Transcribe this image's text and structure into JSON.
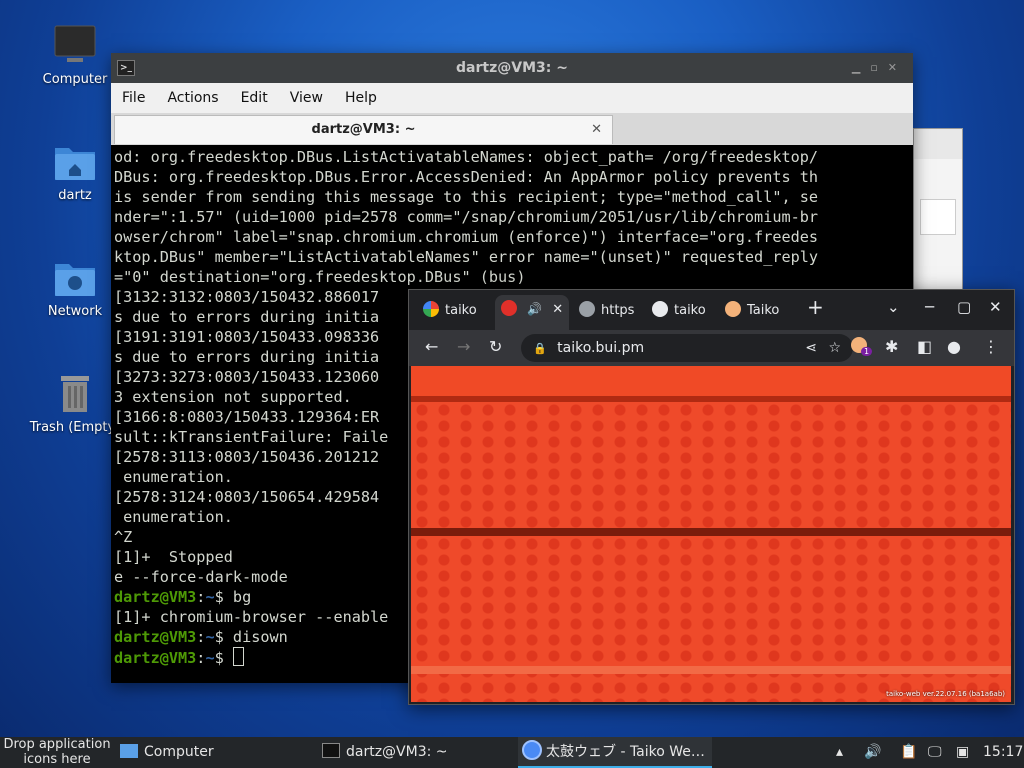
{
  "desktop": {
    "icons": [
      {
        "label": "Computer"
      },
      {
        "label": "dartz"
      },
      {
        "label": "Network"
      },
      {
        "label": "Trash (Empty)"
      }
    ]
  },
  "terminal": {
    "title": "dartz@VM3: ~",
    "menu": [
      "File",
      "Actions",
      "Edit",
      "View",
      "Help"
    ],
    "tab_title": "dartz@VM3: ~",
    "lines": [
      "od: org.freedesktop.DBus.ListActivatableNames: object_path= /org/freedesktop/",
      "DBus: org.freedesktop.DBus.Error.AccessDenied: An AppArmor policy prevents th",
      "is sender from sending this message to this recipient; type=\"method_call\", se",
      "nder=\":1.57\" (uid=1000 pid=2578 comm=\"/snap/chromium/2051/usr/lib/chromium-br",
      "owser/chrom\" label=\"snap.chromium.chromium (enforce)\") interface=\"org.freedes",
      "ktop.DBus\" member=\"ListActivatableNames\" error name=\"(unset)\" requested_reply",
      "=\"0\" destination=\"org.freedesktop.DBus\" (bus)",
      "[3132:3132:0803/150432.886017",
      "s due to errors during initia",
      "[3191:3191:0803/150433.098336",
      "s due to errors during initia",
      "[3273:3273:0803/150433.123060",
      "3 extension not supported.",
      "[3166:8:0803/150433.129364:ER",
      "sult::kTransientFailure: Faile",
      "[2578:3113:0803/150436.201212",
      " enumeration.",
      "[2578:3124:0803/150654.429584",
      " enumeration.",
      "^Z",
      "[1]+  Stopped",
      "e --force-dark-mode"
    ],
    "prompt_user": "dartz@VM3",
    "prompt_path": "~",
    "prompt_symbol": "$",
    "cmd1": "bg",
    "job_line": "[1]+ chromium-browser --enable",
    "cmd2": "disown"
  },
  "browser": {
    "tabs": [
      "taiko",
      "",
      "https",
      "taiko",
      "Taiko"
    ],
    "url": "taiko.bui.pm",
    "ext_badge": "1",
    "version": "taiko-web ver.22.07.16 (ba1a6ab)"
  },
  "taskbar": {
    "drop_hint_line1": "Drop application",
    "drop_hint_line2": "icons here",
    "computer_label": "Computer",
    "terminal_label": "dartz@VM3: ~",
    "browser_label": "太鼓ウェブ - Taiko We…",
    "clock": "15:17"
  }
}
